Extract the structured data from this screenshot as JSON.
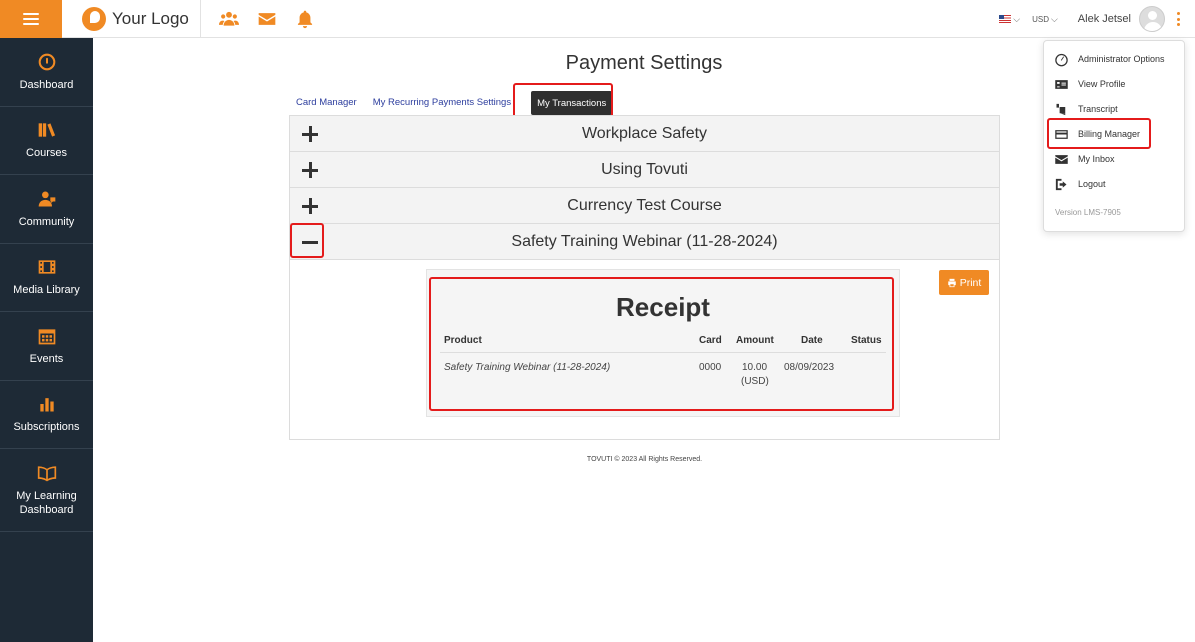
{
  "header": {
    "logo_text": "Your Logo",
    "flag_icon": "us-flag-icon",
    "currency": "USD",
    "username": "Alek Jetsel"
  },
  "sidebar": {
    "items": [
      {
        "label": "Dashboard",
        "icon": "gauge-icon"
      },
      {
        "label": "Courses",
        "icon": "books-icon"
      },
      {
        "label": "Community",
        "icon": "community-icon"
      },
      {
        "label": "Media Library",
        "icon": "film-icon"
      },
      {
        "label": "Events",
        "icon": "calendar-icon"
      },
      {
        "label": "Subscriptions",
        "icon": "bar-chart-icon"
      },
      {
        "label": "My Learning Dashboard",
        "icon": "open-book-icon"
      }
    ]
  },
  "page": {
    "title": "Payment Settings",
    "tabs": [
      {
        "label": "Card Manager",
        "active": false
      },
      {
        "label": "My Recurring Payments Settings",
        "active": false
      },
      {
        "label": "My Transactions",
        "active": true
      }
    ]
  },
  "accordion": [
    {
      "title": "Workplace Safety",
      "expanded": false
    },
    {
      "title": "Using Tovuti",
      "expanded": false
    },
    {
      "title": "Currency Test Course",
      "expanded": false
    },
    {
      "title": "Safety Training Webinar (11-28-2024)",
      "expanded": true
    }
  ],
  "receipt": {
    "title": "Receipt",
    "print_label": "Print",
    "columns": [
      "Product",
      "Card",
      "Amount",
      "Date",
      "Status"
    ],
    "row": {
      "product": "Safety Training Webinar (11-28-2024)",
      "card": "0000",
      "amount": "10.00",
      "amount_currency": "(USD)",
      "date": "08/09/2023",
      "status": ""
    }
  },
  "footer": {
    "text": "TOVUTI © 2023 All Rights Reserved."
  },
  "user_menu": {
    "items": [
      {
        "label": "Administrator Options",
        "icon": "gauge-outline-icon"
      },
      {
        "label": "View Profile",
        "icon": "id-card-icon"
      },
      {
        "label": "Transcript",
        "icon": "transcript-icon"
      },
      {
        "label": "Billing Manager",
        "icon": "credit-card-icon"
      },
      {
        "label": "My Inbox",
        "icon": "envelope-icon"
      },
      {
        "label": "Logout",
        "icon": "logout-icon"
      }
    ],
    "version": "Version LMS-7905"
  },
  "colors": {
    "accent": "#f08a24",
    "sidebar_bg": "#1e2a36",
    "highlight": "#e41b1b",
    "link": "#2d3e9e"
  }
}
